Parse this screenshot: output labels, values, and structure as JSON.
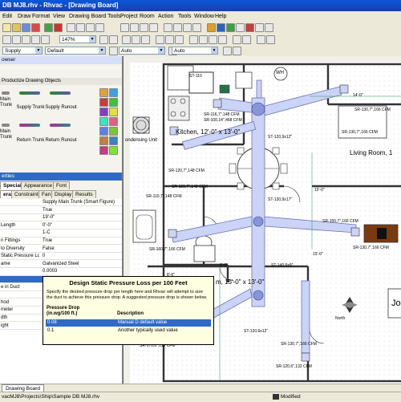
{
  "window": {
    "title": "DB MJ8.rhv - Rhvac - [Drawing Board]"
  },
  "menu": [
    "Edit",
    "Draw",
    "Format",
    "View",
    "Drawing Board Tools",
    "Project",
    "Room",
    "Action",
    "Tools",
    "Window",
    "Help"
  ],
  "toolbar": {
    "zoom": "147%",
    "layer": "Supply Ductwork",
    "style": "Default",
    "auto1": "Auto",
    "auto2": "Auto"
  },
  "browser": {
    "title": "owser",
    "category": "Productize Drawing Objects",
    "items": [
      "Main Trunk",
      "Supply Trunk",
      "Supply Runout",
      "Main Trunk",
      "Return Trunk",
      "Return Runout"
    ]
  },
  "properties": {
    "title": "erties",
    "tabs_row1": [
      "Special",
      "Appearance",
      "Font"
    ],
    "tabs_row2": [
      "eral",
      "Constraints",
      "Fan",
      "Display",
      "Results"
    ],
    "rows": [
      {
        "name": "",
        "value": "Supply Main Trunk (Smart Figure)"
      },
      {
        "name": "",
        "value": "True"
      },
      {
        "name": "",
        "value": "19'-0\""
      },
      {
        "name": "Length",
        "value": "0'-0\""
      },
      {
        "name": "",
        "value": "1-C"
      },
      {
        "name": "n Fittings",
        "value": "True"
      },
      {
        "name": "to Diversity",
        "value": "False"
      },
      {
        "name": "Static Pressure Loss",
        "value": "0"
      },
      {
        "name": "ame",
        "value": "Galvanized Steel"
      },
      {
        "name": "",
        "value": "0.0003"
      },
      {
        "name": "",
        "value": "0.08"
      },
      {
        "name": "e in Duct",
        "value": ""
      },
      {
        "name": "",
        "value": ""
      },
      {
        "name": "hod",
        "value": ""
      },
      {
        "name": "meter",
        "value": ""
      },
      {
        "name": "dth",
        "value": ""
      },
      {
        "name": "ight",
        "value": ""
      }
    ]
  },
  "tooltip": {
    "title": "Design Static Pressure Loss per 100 Feet",
    "desc": "Specify the desired pressure drop per length here and Rhvac will attempt to size the duct to achieve this pressure drop. A suggested pressure drop is shown below.",
    "col1": "Pressure Drop",
    "col1b": "(in.wg/100 ft.)",
    "col2": "Description",
    "options": [
      {
        "value": "0.08",
        "desc": "Manual D default value"
      },
      {
        "value": "0.1",
        "desc": "Another typically used value"
      }
    ]
  },
  "drawing": {
    "rooms": [
      {
        "label": "Kitchen, 12'-0\" x 13'-0\""
      },
      {
        "label": "Living Room, 1"
      },
      {
        "label": "m, 15'-0\" x 13'-0\""
      },
      {
        "label": "Jo"
      }
    ],
    "labels": {
      "condensing": "ondensing Unit",
      "wh": "WH",
      "north": "North",
      "dim1": "14'-0\"",
      "dim2": "15'-0\"",
      "dim3": "8'-6\"",
      "dim4": "6'-0\"",
      "dim5": "15'-0\""
    },
    "cfm": [
      "ST-110",
      "SR-116,7\",148 CFM",
      "SR-100,14\",468 CFM",
      "SR-130,7\",166 CFM",
      "SR-130,7\",166 CFM",
      "ST-120,9x12\"",
      "SR-120,7\",148 CFM",
      "ST-130,9x17\"",
      "SR-120,7\",148 CFM",
      "SR-160,7\",166 CFM",
      "SR-150,7\",166 CFM",
      "SR-130,7\",166 CFM",
      "ST-140,6x9\"",
      "SR-170,6\",115 CFM",
      "SR-130,7\",166 CFM",
      "SR-120,6\",132 CFM",
      "ST-120,6x12\"",
      "SR-110,7\",148 CFM"
    ]
  },
  "doc_tab": "Drawing Board",
  "status": {
    "path": "vacMJ8\\Projects\\Ship\\Sample DB MJ8.rhv",
    "modified": "Modified"
  }
}
